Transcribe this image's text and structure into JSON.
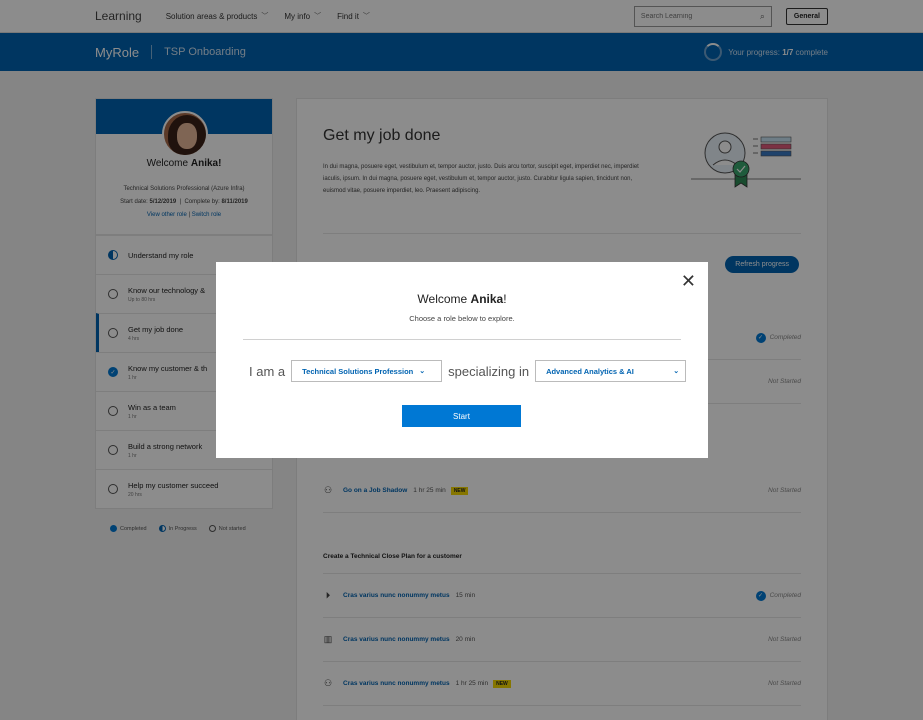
{
  "topnav": {
    "brand": "Learning",
    "items": [
      "Solution areas & products",
      "My info",
      "Find it"
    ],
    "search_placeholder": "Search Learning",
    "general_label": "General"
  },
  "bluebar": {
    "app": "MyRole",
    "breadcrumb": "TSP Onboarding",
    "progress_prefix": "Your progress: ",
    "progress_value": "1/7",
    "progress_suffix": " complete"
  },
  "sidebar": {
    "welcome_prefix": "Welcome ",
    "user_name": "Anika!",
    "role": "Technical Solutions Professional (Azure Infra)",
    "start_label": "Start date: ",
    "start_date": "5/12/2019",
    "complete_label": "Complete by: ",
    "complete_date": "8/11/2019",
    "view_other": "View other role",
    "switch_role": "Switch role",
    "modules": [
      {
        "title": "Understand my role",
        "sub": "",
        "status": "in-progress"
      },
      {
        "title": "Know our technology &",
        "sub": "Up to 80 hrs",
        "status": "not-started"
      },
      {
        "title": "Get my job done",
        "sub": "4 hrs",
        "status": "not-started"
      },
      {
        "title": "Know my customer & th",
        "sub": "1 hr",
        "status": "completed"
      },
      {
        "title": "Win as a team",
        "sub": "1 hr",
        "status": "not-started"
      },
      {
        "title": "Build a strong network",
        "sub": "1 hr",
        "status": "not-started"
      },
      {
        "title": "Help my customer succeed",
        "sub": "20 hrs",
        "status": "not-started"
      }
    ],
    "legend": [
      "Completed",
      "In Progress",
      "Not started"
    ]
  },
  "main": {
    "title": "Get my job done",
    "description": "In dui magna, posuere eget, vestibulum et, tempor auctor, justo. Duis arcu tortor, suscipit eget, imperdiet nec, imperdiet iaculis, ipsum. In dui magna, posuere eget, vestibulum et, tempor auctor, justo. Curabitur ligula sapien, tincidunt non, euismod vitae, posuere imperdiet, leo. Praesent adipiscing.",
    "refresh_label": "Refresh progress",
    "status_completed": "Completed",
    "status_not_started": "Not Started",
    "shadow_row": {
      "title": "Go on a Job Shadow",
      "duration": "1 hr 25 min",
      "badge": "NEW"
    },
    "section_title": "Create a Technical Close Plan for a customer",
    "rows": [
      {
        "icon": "play-icon",
        "title": "Cras varius nunc nonummy metus",
        "duration": "15 min",
        "badge": "",
        "status": "Completed"
      },
      {
        "icon": "book-icon",
        "title": "Cras varius nunc nonummy metus",
        "duration": "20 min",
        "badge": "",
        "status": "Not Started"
      },
      {
        "icon": "people-icon",
        "title": "Cras varius nunc nonummy metus",
        "duration": "1 hr 25 min",
        "badge": "NEW",
        "status": "Not Started"
      }
    ]
  },
  "modal": {
    "title_prefix": "Welcome ",
    "title_name": "Anika",
    "title_suffix": "!",
    "subtitle": "Choose a role below to explore.",
    "i_am": "I am a",
    "role_value": "Technical Solutions Profession",
    "specializing": "specializing in",
    "specialty_value": "Advanced Analytics & AI",
    "start_label": "Start"
  },
  "colors": {
    "brand_blue": "#0063b1",
    "button_blue": "#0078d4",
    "badge_yellow": "#f5d800"
  }
}
